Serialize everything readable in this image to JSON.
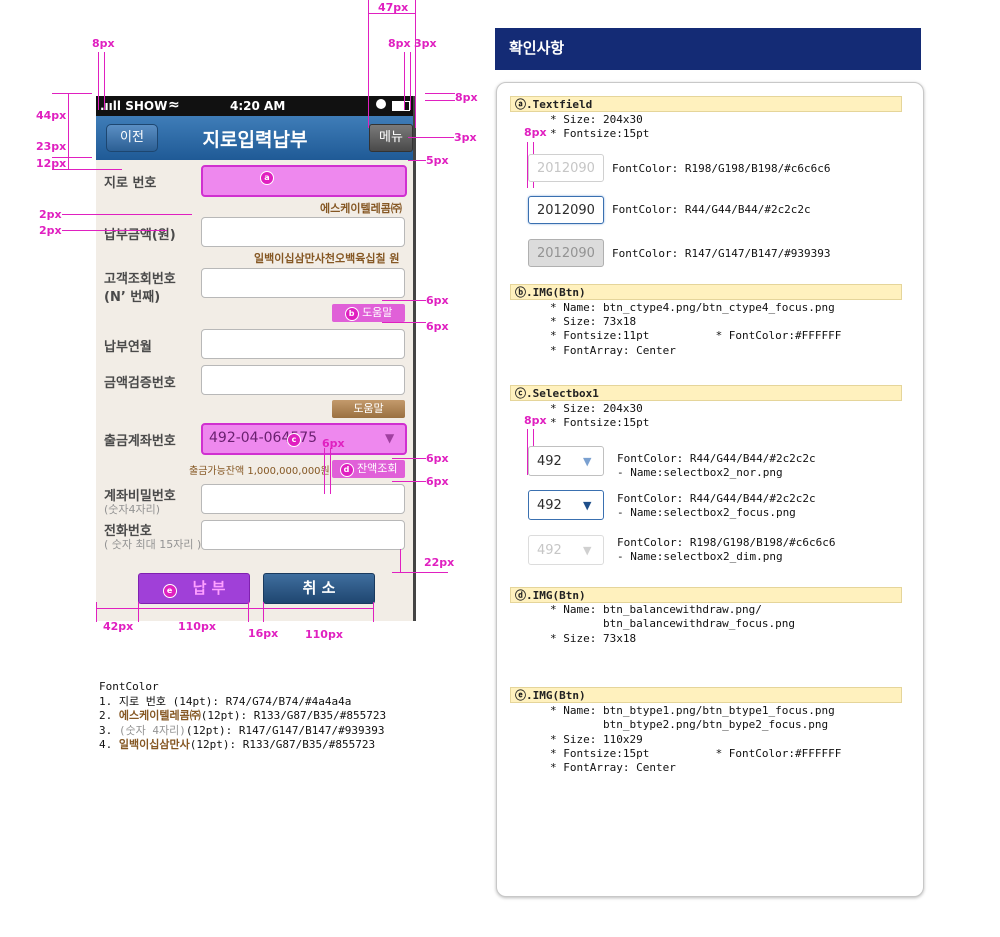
{
  "phone": {
    "status": {
      "carrier": ".ııll SHOW",
      "time": "4:20 AM"
    },
    "nav": {
      "back": "이전",
      "title": "지로입력납부",
      "menu": "메뉴"
    },
    "fields": [
      {
        "label": "지로 번호",
        "value": "",
        "marker": "a"
      },
      {
        "label": "납부금액(원)",
        "value": ""
      },
      {
        "label": "고객조회번호",
        "label2": "(N’ 번째)",
        "value": ""
      },
      {
        "label": "납부연월",
        "value": ""
      },
      {
        "label": "금액검증번호",
        "value": ""
      },
      {
        "label": "출금계좌번호",
        "value": "492-04-064575",
        "marker": "c"
      },
      {
        "label": "계좌비밀번호",
        "sub": "(숫자4자리)",
        "value": ""
      },
      {
        "label": "전화번호",
        "sub": "( 숫자 최대 15자리 )",
        "value": ""
      }
    ],
    "company": "에스케이텔레콤㈜",
    "amount_text": "일백이십삼만사천오백육십칠 원",
    "help_label": "도움말",
    "help_marker": "b",
    "balance_text": "출금가능잔액 1,000,000,000원",
    "balance_btn": "잔액조회",
    "balance_marker": "d",
    "pay_btn": "납 부",
    "pay_marker": "e",
    "cancel_btn": "취 소"
  },
  "dimensions": {
    "d47": "47px",
    "d8a": "8px",
    "d8b": "8px",
    "d3a": "3px",
    "d8c": "8px",
    "d44": "44px",
    "d23": "23px",
    "d12": "12px",
    "d3b": "3px",
    "d5": "5px",
    "d2a": "2px",
    "d2b": "2px",
    "d6a": "6px",
    "d6b": "6px",
    "d6c": "6px",
    "d6d": "6px",
    "d6e": "6px",
    "d22": "22px",
    "d42": "42px",
    "d110a": "110px",
    "d16": "16px",
    "d110b": "110px"
  },
  "fontcolor": {
    "title": "FontColor",
    "l1a": "1. 지로 번호 (14pt): R74/G74/B74/#4a4a4a",
    "l2pre": "2. ",
    "l2name": "에스케이텔레콤㈜",
    "l2rest": "(12pt): R133/G87/B35/#855723",
    "l3pre": "3. ",
    "l3name": "(숫자 4자리)",
    "l3rest": "(12pt): R147/G147/B147/#939393",
    "l4pre": "4. ",
    "l4name": "일백이십삼만사",
    "l4rest": "(12pt): R133/G87/B35/#855723"
  },
  "panel": {
    "header": "확인사항",
    "a": {
      "title": "ⓐ.Textfield",
      "lines": [
        "* Size: 204x30",
        "* Fontsize:15pt"
      ],
      "samples": [
        {
          "value": "2012090",
          "desc": "FontColor: R198/G198/B198/#c6c6c6"
        },
        {
          "value": "2012090",
          "desc": "FontColor: R44/G44/B44/#2c2c2c"
        },
        {
          "value": "2012090",
          "desc": "FontColor: R147/G147/B147/#939393"
        }
      ]
    },
    "b": {
      "title": "ⓑ.IMG(Btn)",
      "lines": [
        "* Name: btn_ctype4.png/btn_ctype4_focus.png",
        "* Size: 73x18",
        "* Fontsize:11pt          * FontColor:#FFFFFF",
        "* FontArray: Center"
      ]
    },
    "c": {
      "title": "ⓒ.Selectbox1",
      "lines": [
        "* Size: 204x30",
        "* Fontsize:15pt"
      ],
      "samples": [
        {
          "value": "492",
          "desc1": "FontColor: R44/G44/B44/#2c2c2c",
          "desc2": "- Name:selectbox2_nor.png"
        },
        {
          "value": "492",
          "desc1": "FontColor: R44/G44/B44/#2c2c2c",
          "desc2": "- Name:selectbox2_focus.png"
        },
        {
          "value": "492",
          "desc1": "FontColor: R198/G198/B198/#c6c6c6",
          "desc2": "- Name:selectbox2_dim.png"
        }
      ]
    },
    "d": {
      "title": "ⓓ.IMG(Btn)",
      "lines": [
        "* Name: btn_balancewithdraw.png/",
        "        btn_balancewithdraw_focus.png",
        "* Size: 73x18"
      ]
    },
    "e": {
      "title": "ⓔ.IMG(Btn)",
      "lines": [
        "* Name: btn_btype1.png/btn_btype1_focus.png",
        "        btn_btype2.png/btn_bype2_focus.png",
        "* Size: 110x29",
        "* Fontsize:15pt          * FontColor:#FFFFFF",
        "* FontArray: Center"
      ]
    },
    "dim8a": "8px",
    "dim8b": "8px"
  }
}
